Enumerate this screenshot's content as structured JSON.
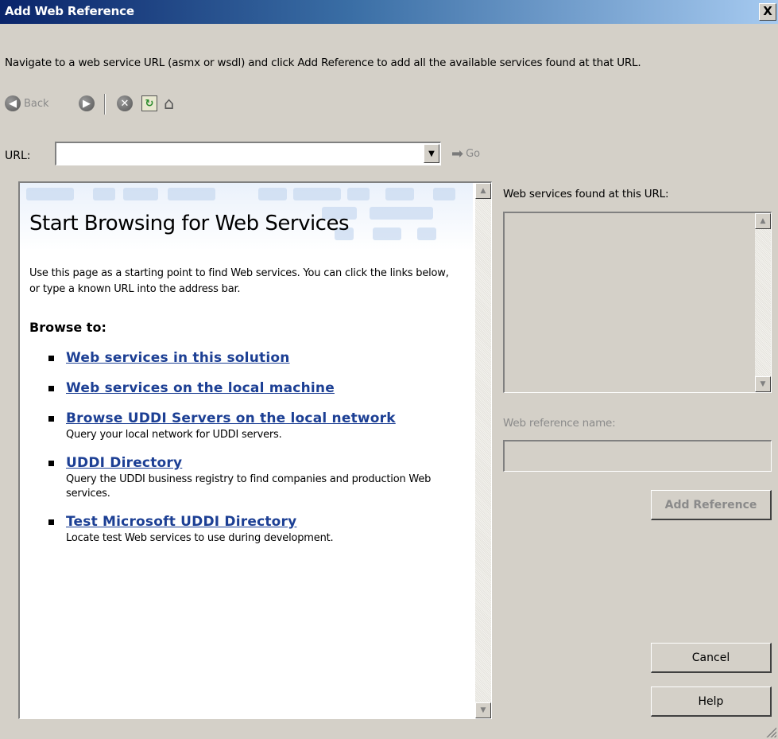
{
  "window": {
    "title": "Add Web Reference",
    "close_label": "X"
  },
  "instructions": "Navigate to a web service URL (asmx or wsdl) and click Add Reference to add all the available services found at that URL.",
  "toolbar": {
    "back_label": "Back",
    "back_icon": "back-arrow-icon",
    "forward_icon": "forward-arrow-icon",
    "stop_icon": "stop-icon",
    "refresh_icon": "refresh-icon",
    "home_icon": "home-icon"
  },
  "url_bar": {
    "label": "URL:",
    "value": "",
    "go_label": "Go"
  },
  "browser": {
    "heading": "Start Browsing for Web Services",
    "intro": "Use this page as a starting point to find Web services. You can click the links below, or type a known URL into the address bar.",
    "browse_to": "Browse to:",
    "links": [
      {
        "label": "Web services in this solution",
        "desc": ""
      },
      {
        "label": "Web services on the local machine",
        "desc": ""
      },
      {
        "label": "Browse UDDI Servers on the local network",
        "desc": "Query your local network for UDDI servers."
      },
      {
        "label": "UDDI Directory",
        "desc": "Query the UDDI business registry to find companies and production Web services."
      },
      {
        "label": "Test Microsoft UDDI Directory",
        "desc": "Locate test Web services to use during development."
      }
    ]
  },
  "right_panel": {
    "services_label": "Web services found at this URL:",
    "ref_name_label": "Web reference name:",
    "ref_name_value": "",
    "add_reference_label": "Add Reference",
    "cancel_label": "Cancel",
    "help_label": "Help"
  },
  "colors": {
    "dialog_bg": "#d4d0c8",
    "title_start": "#0a246a",
    "title_end": "#a6caf0",
    "link": "#1c3f94"
  }
}
